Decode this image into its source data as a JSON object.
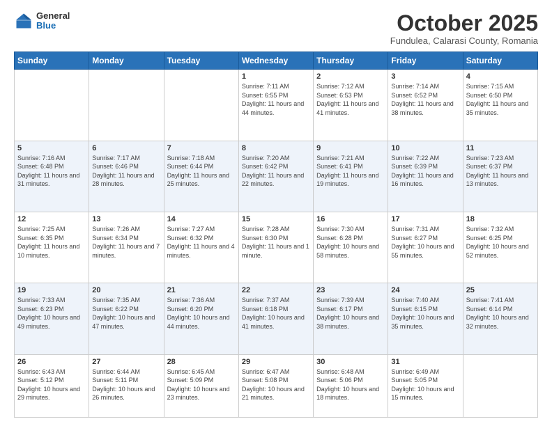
{
  "header": {
    "logo": {
      "general": "General",
      "blue": "Blue"
    },
    "title": "October 2025",
    "subtitle": "Fundulea, Calarasi County, Romania"
  },
  "days_of_week": [
    "Sunday",
    "Monday",
    "Tuesday",
    "Wednesday",
    "Thursday",
    "Friday",
    "Saturday"
  ],
  "weeks": [
    {
      "days": [
        {
          "num": "",
          "info": ""
        },
        {
          "num": "",
          "info": ""
        },
        {
          "num": "",
          "info": ""
        },
        {
          "num": "1",
          "info": "Sunrise: 7:11 AM\nSunset: 6:55 PM\nDaylight: 11 hours\nand 44 minutes."
        },
        {
          "num": "2",
          "info": "Sunrise: 7:12 AM\nSunset: 6:53 PM\nDaylight: 11 hours\nand 41 minutes."
        },
        {
          "num": "3",
          "info": "Sunrise: 7:14 AM\nSunset: 6:52 PM\nDaylight: 11 hours\nand 38 minutes."
        },
        {
          "num": "4",
          "info": "Sunrise: 7:15 AM\nSunset: 6:50 PM\nDaylight: 11 hours\nand 35 minutes."
        }
      ]
    },
    {
      "days": [
        {
          "num": "5",
          "info": "Sunrise: 7:16 AM\nSunset: 6:48 PM\nDaylight: 11 hours\nand 31 minutes."
        },
        {
          "num": "6",
          "info": "Sunrise: 7:17 AM\nSunset: 6:46 PM\nDaylight: 11 hours\nand 28 minutes."
        },
        {
          "num": "7",
          "info": "Sunrise: 7:18 AM\nSunset: 6:44 PM\nDaylight: 11 hours\nand 25 minutes."
        },
        {
          "num": "8",
          "info": "Sunrise: 7:20 AM\nSunset: 6:42 PM\nDaylight: 11 hours\nand 22 minutes."
        },
        {
          "num": "9",
          "info": "Sunrise: 7:21 AM\nSunset: 6:41 PM\nDaylight: 11 hours\nand 19 minutes."
        },
        {
          "num": "10",
          "info": "Sunrise: 7:22 AM\nSunset: 6:39 PM\nDaylight: 11 hours\nand 16 minutes."
        },
        {
          "num": "11",
          "info": "Sunrise: 7:23 AM\nSunset: 6:37 PM\nDaylight: 11 hours\nand 13 minutes."
        }
      ]
    },
    {
      "days": [
        {
          "num": "12",
          "info": "Sunrise: 7:25 AM\nSunset: 6:35 PM\nDaylight: 11 hours\nand 10 minutes."
        },
        {
          "num": "13",
          "info": "Sunrise: 7:26 AM\nSunset: 6:34 PM\nDaylight: 11 hours\nand 7 minutes."
        },
        {
          "num": "14",
          "info": "Sunrise: 7:27 AM\nSunset: 6:32 PM\nDaylight: 11 hours\nand 4 minutes."
        },
        {
          "num": "15",
          "info": "Sunrise: 7:28 AM\nSunset: 6:30 PM\nDaylight: 11 hours\nand 1 minute."
        },
        {
          "num": "16",
          "info": "Sunrise: 7:30 AM\nSunset: 6:28 PM\nDaylight: 10 hours\nand 58 minutes."
        },
        {
          "num": "17",
          "info": "Sunrise: 7:31 AM\nSunset: 6:27 PM\nDaylight: 10 hours\nand 55 minutes."
        },
        {
          "num": "18",
          "info": "Sunrise: 7:32 AM\nSunset: 6:25 PM\nDaylight: 10 hours\nand 52 minutes."
        }
      ]
    },
    {
      "days": [
        {
          "num": "19",
          "info": "Sunrise: 7:33 AM\nSunset: 6:23 PM\nDaylight: 10 hours\nand 49 minutes."
        },
        {
          "num": "20",
          "info": "Sunrise: 7:35 AM\nSunset: 6:22 PM\nDaylight: 10 hours\nand 47 minutes."
        },
        {
          "num": "21",
          "info": "Sunrise: 7:36 AM\nSunset: 6:20 PM\nDaylight: 10 hours\nand 44 minutes."
        },
        {
          "num": "22",
          "info": "Sunrise: 7:37 AM\nSunset: 6:18 PM\nDaylight: 10 hours\nand 41 minutes."
        },
        {
          "num": "23",
          "info": "Sunrise: 7:39 AM\nSunset: 6:17 PM\nDaylight: 10 hours\nand 38 minutes."
        },
        {
          "num": "24",
          "info": "Sunrise: 7:40 AM\nSunset: 6:15 PM\nDaylight: 10 hours\nand 35 minutes."
        },
        {
          "num": "25",
          "info": "Sunrise: 7:41 AM\nSunset: 6:14 PM\nDaylight: 10 hours\nand 32 minutes."
        }
      ]
    },
    {
      "days": [
        {
          "num": "26",
          "info": "Sunrise: 6:43 AM\nSunset: 5:12 PM\nDaylight: 10 hours\nand 29 minutes."
        },
        {
          "num": "27",
          "info": "Sunrise: 6:44 AM\nSunset: 5:11 PM\nDaylight: 10 hours\nand 26 minutes."
        },
        {
          "num": "28",
          "info": "Sunrise: 6:45 AM\nSunset: 5:09 PM\nDaylight: 10 hours\nand 23 minutes."
        },
        {
          "num": "29",
          "info": "Sunrise: 6:47 AM\nSunset: 5:08 PM\nDaylight: 10 hours\nand 21 minutes."
        },
        {
          "num": "30",
          "info": "Sunrise: 6:48 AM\nSunset: 5:06 PM\nDaylight: 10 hours\nand 18 minutes."
        },
        {
          "num": "31",
          "info": "Sunrise: 6:49 AM\nSunset: 5:05 PM\nDaylight: 10 hours\nand 15 minutes."
        },
        {
          "num": "",
          "info": ""
        }
      ]
    }
  ],
  "colors": {
    "header_bg": "#2a72b8",
    "accent": "#1a6eb5"
  }
}
